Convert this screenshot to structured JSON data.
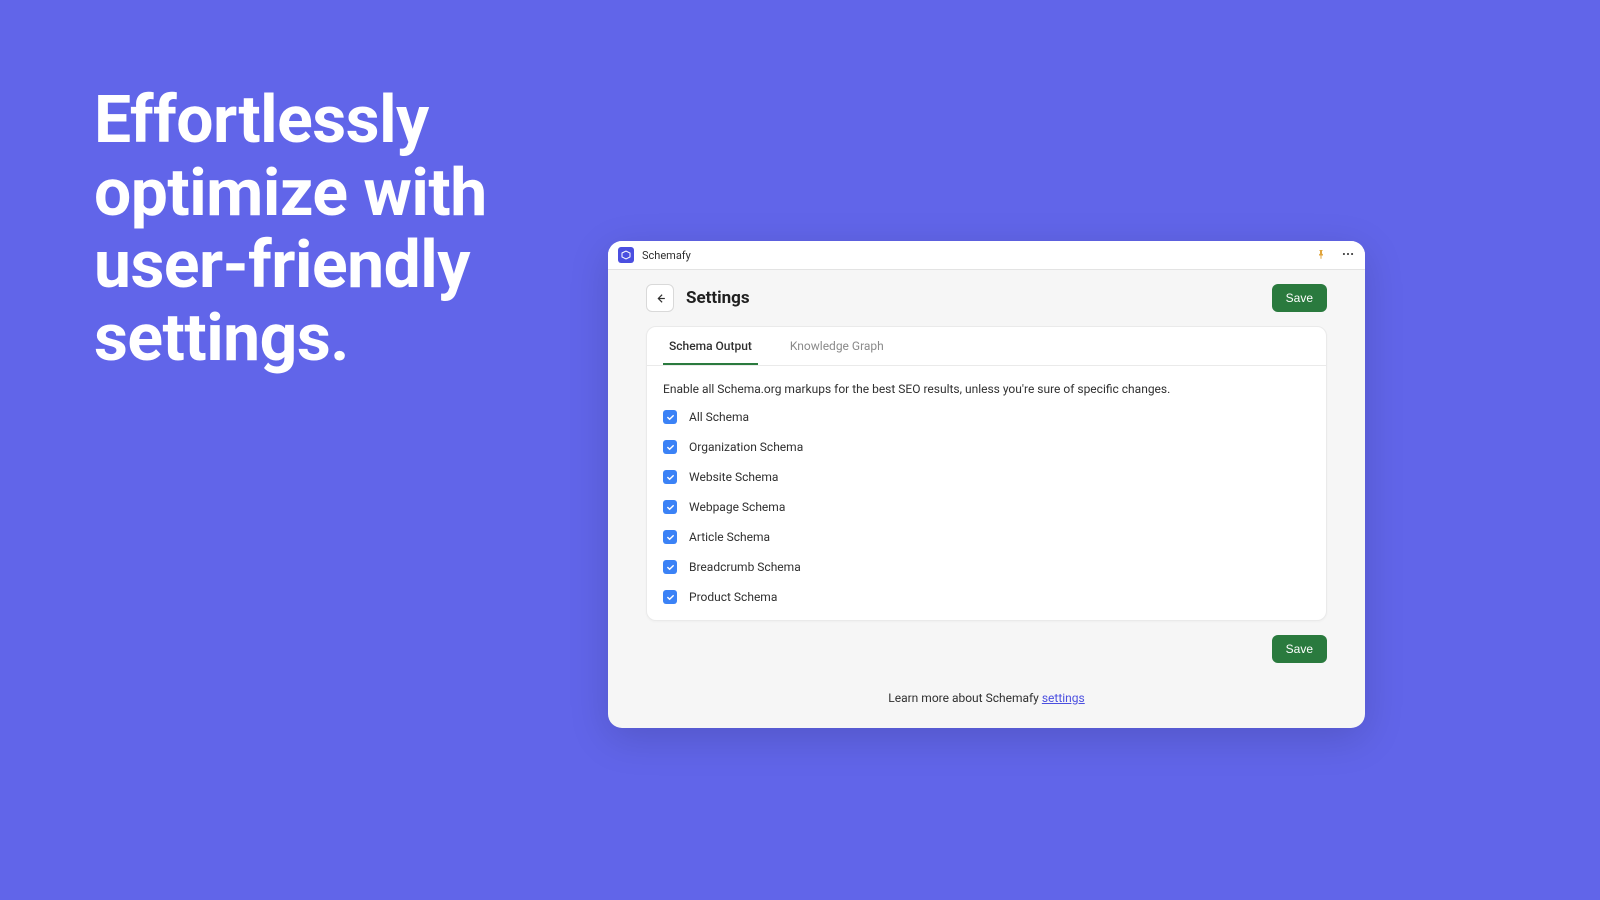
{
  "hero": {
    "headline": "Effortlessly optimize with user-friendly settings."
  },
  "window": {
    "app_name": "Schemafy",
    "page_title": "Settings",
    "save_label": "Save",
    "tabs": [
      {
        "label": "Schema Output",
        "active": true
      },
      {
        "label": "Knowledge Graph",
        "active": false
      }
    ],
    "hint": "Enable all Schema.org markups for the best SEO results, unless you're sure of specific changes.",
    "checkboxes": [
      {
        "label": "All Schema",
        "checked": true
      },
      {
        "label": "Organization Schema",
        "checked": true
      },
      {
        "label": "Website Schema",
        "checked": true
      },
      {
        "label": "Webpage Schema",
        "checked": true
      },
      {
        "label": "Article Schema",
        "checked": true
      },
      {
        "label": "Breadcrumb Schema",
        "checked": true
      },
      {
        "label": "Product Schema",
        "checked": true
      }
    ],
    "footer_prefix": "Learn more about Schemafy ",
    "footer_link": "settings"
  }
}
